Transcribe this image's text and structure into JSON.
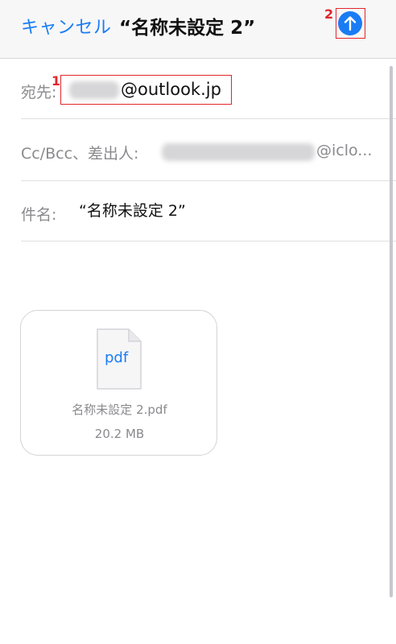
{
  "navbar": {
    "cancel_label": "キャンセル",
    "title": "“名称未設定 2”",
    "send_icon": "arrow-up-circle-icon"
  },
  "markers": {
    "one": "1",
    "two": "2"
  },
  "to_field": {
    "label": "宛先:",
    "address_domain": "@outlook.jp"
  },
  "cc_field": {
    "label": "Cc/Bcc、差出人:",
    "address_suffix": "@iclo..."
  },
  "subject_field": {
    "label": "件名:",
    "value": "“名称未設定 2”"
  },
  "attachment": {
    "icon_text": "pdf",
    "file_name": "名称未設定 2.pdf",
    "file_size": "20.2 MB"
  },
  "colors": {
    "accent": "#1a7cf5",
    "annotation": "#e2262c"
  }
}
